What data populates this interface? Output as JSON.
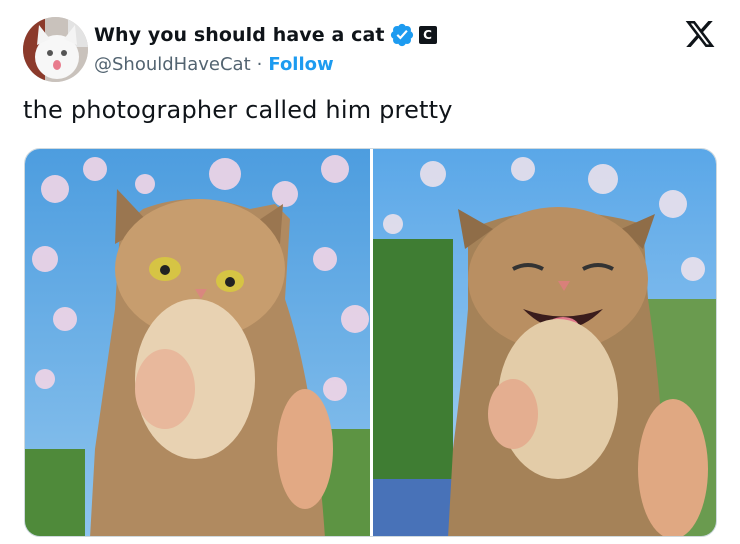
{
  "tweet": {
    "author": {
      "display_name": "Why you should have a cat",
      "handle": "@ShouldHaveCat",
      "separator": "·",
      "follow_label": "Follow",
      "verified": true,
      "affiliate_badge": "C"
    },
    "text": "the photographer called him pretty",
    "media_count": 2
  },
  "icons": {
    "verified": "verified-badge-icon",
    "brand": "x-logo-icon"
  },
  "colors": {
    "link": "#1d9bf0",
    "secondary_text": "#536471",
    "primary_text": "#0f1419"
  }
}
